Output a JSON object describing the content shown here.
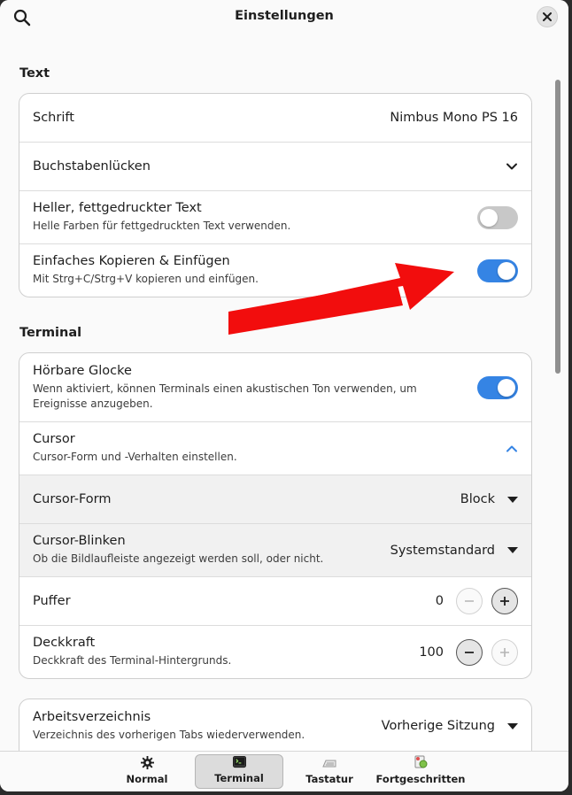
{
  "header": {
    "title": "Einstellungen"
  },
  "sections": {
    "text": {
      "title": "Text",
      "font": {
        "label": "Schrift",
        "value": "Nimbus Mono PS 16"
      },
      "spacing": {
        "label": "Buchstabenlücken"
      },
      "bright_bold": {
        "label": "Heller, fettgedruckter Text",
        "sub": "Helle Farben für fettgedruckten Text verwenden.",
        "enabled": false
      },
      "easy_copy": {
        "label": "Einfaches Kopieren & Einfügen",
        "sub": "Mit Strg+C/Strg+V kopieren und einfügen.",
        "enabled": true
      }
    },
    "terminal": {
      "title": "Terminal",
      "bell": {
        "label": "Hörbare Glocke",
        "sub": "Wenn aktiviert, können Terminals einen akustischen Ton verwenden, um Ereignisse anzugeben.",
        "enabled": true
      },
      "cursor": {
        "label": "Cursor",
        "sub": "Cursor-Form und -Verhalten einstellen."
      },
      "cursor_shape": {
        "label": "Cursor-Form",
        "value": "Block"
      },
      "cursor_blink": {
        "label": "Cursor-Blinken",
        "sub": "Ob die Bildlaufleiste angezeigt werden soll, oder nicht.",
        "value": "Systemstandard"
      },
      "buffer": {
        "label": "Puffer",
        "value": "0"
      },
      "opacity": {
        "label": "Deckkraft",
        "sub": "Deckkraft des Terminal-Hintergrunds.",
        "value": "100"
      }
    },
    "workdir": {
      "label": "Arbeitsverzeichnis",
      "sub": "Verzeichnis des vorherigen Tabs wiederverwenden.",
      "value": "Vorherige Sitzung"
    }
  },
  "tabs": [
    {
      "label": "Normal",
      "icon": "gear-icon"
    },
    {
      "label": "Terminal",
      "icon": "terminal-icon",
      "active": true
    },
    {
      "label": "Tastatur",
      "icon": "keyboard-icon"
    },
    {
      "label": "Fortgeschritten",
      "icon": "advanced-icon"
    }
  ],
  "colors": {
    "accent": "#3584e4",
    "annotation_arrow": "#f20d0d"
  }
}
